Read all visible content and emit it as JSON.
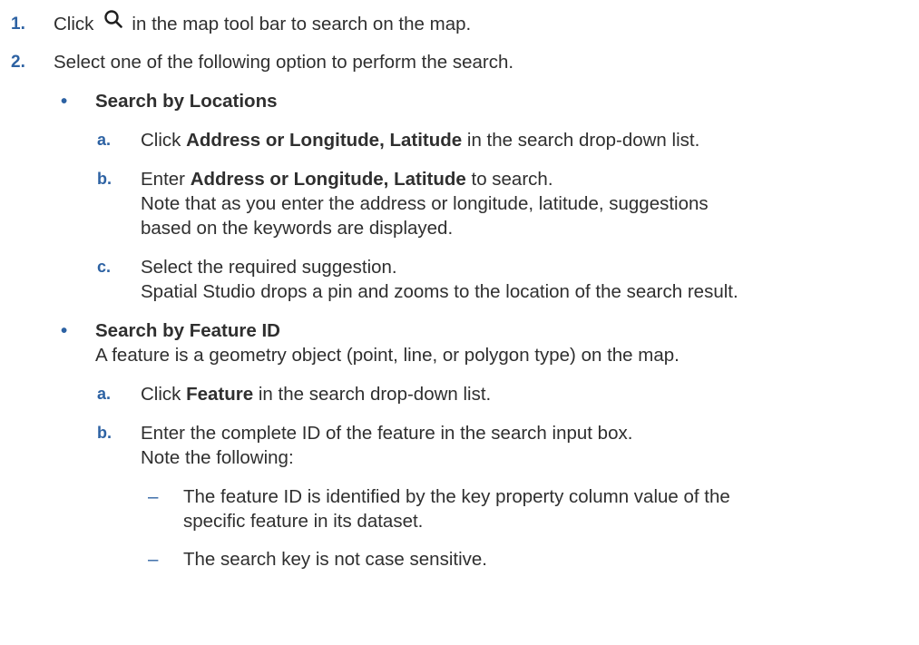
{
  "steps": [
    {
      "number": "1.",
      "before": "Click",
      "icon": "search-icon",
      "after": "in the map tool bar to search on the map."
    },
    {
      "number": "2.",
      "text": "Select one of the following option to perform the search."
    }
  ],
  "bullets": [
    {
      "marker": "•",
      "title": "Search by Locations",
      "substeps": [
        {
          "letter": "a.",
          "pre": "Click ",
          "bold": "Address or Longitude, Latitude",
          "post": " in the search drop-down list."
        },
        {
          "letter": "b.",
          "pre": "Enter ",
          "bold": "Address or Longitude, Latitude",
          "post": " to search.",
          "note1": "Note that as you enter the address or longitude, latitude, suggestions",
          "note2": "based on the keywords are displayed."
        },
        {
          "letter": "c.",
          "line1": "Select the required suggestion.",
          "line2": "Spatial Studio drops a pin and zooms to the location of the search result."
        }
      ]
    },
    {
      "marker": "•",
      "title": "Search by Feature ID",
      "description": "A feature is a geometry object (point, line, or polygon type) on the map.",
      "substeps": [
        {
          "letter": "a.",
          "pre": "Click ",
          "bold": "Feature",
          "post": " in the search drop-down list."
        },
        {
          "letter": "b.",
          "line1": "Enter the complete ID of the feature in the search input box.",
          "line2": "Note the following:"
        }
      ],
      "notes": [
        {
          "marker": "–",
          "line1": "The feature ID is identified by the key property column value of the",
          "line2": "specific feature in its dataset."
        },
        {
          "marker": "–",
          "line1": "The search key is not case sensitive."
        }
      ]
    }
  ]
}
